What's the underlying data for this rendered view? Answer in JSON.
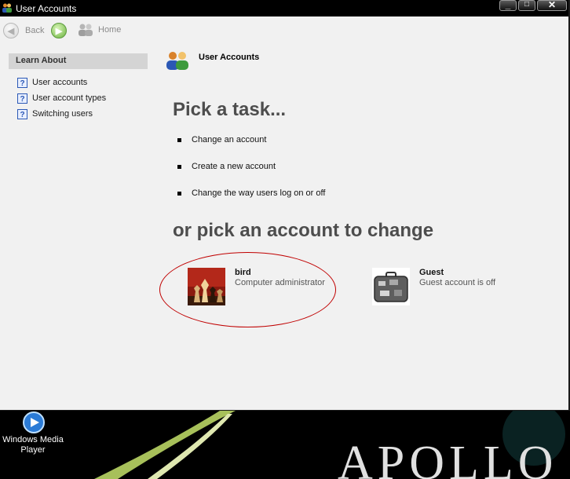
{
  "window": {
    "title": "User Accounts",
    "controls": {
      "minimize": "minimize",
      "maximize": "maximize",
      "close": "close"
    }
  },
  "toolbar": {
    "back_label": "Back",
    "home_label": "Home"
  },
  "sidebar": {
    "header": "Learn About",
    "items": [
      {
        "label": "User accounts",
        "icon": "help-icon"
      },
      {
        "label": "User account types",
        "icon": "help-icon"
      },
      {
        "label": "Switching users",
        "icon": "help-icon"
      }
    ]
  },
  "main": {
    "section_title": "User Accounts",
    "pick_task_heading": "Pick a task...",
    "tasks": [
      {
        "label": "Change an account"
      },
      {
        "label": "Create a new account"
      },
      {
        "label": "Change the way users log on or off"
      }
    ],
    "pick_account_heading": "or pick an account to change",
    "accounts": [
      {
        "name": "bird",
        "type": "Computer administrator",
        "picture": "chess-pieces"
      },
      {
        "name": "Guest",
        "type": "Guest account is off",
        "picture": "suitcase"
      }
    ]
  },
  "desktop": {
    "icon_label": "Windows Media Player",
    "wallpaper_text": "APOLLO"
  },
  "colors": {
    "titlebar": "#000000",
    "window_bg": "#f1f1f1",
    "annotation": "#c00000",
    "heading": "#4d4d4d"
  }
}
